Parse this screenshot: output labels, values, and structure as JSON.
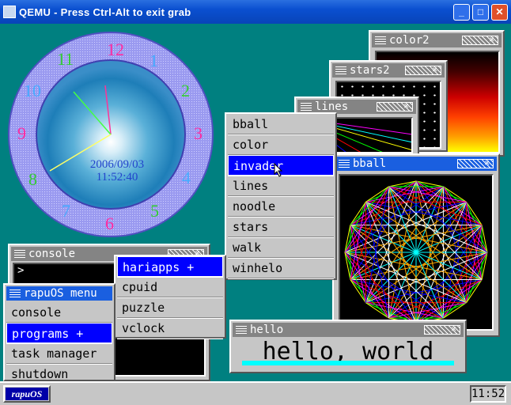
{
  "host": {
    "title": "QEMU - Press Ctrl-Alt to exit grab",
    "buttons": {
      "minimize": "_",
      "maximize": "□",
      "close": "✕"
    }
  },
  "clock_widget": {
    "date": "2006/09/03",
    "time": "11:52:40",
    "numbers": [
      "12",
      "1",
      "2",
      "3",
      "4",
      "5",
      "6",
      "7",
      "8",
      "9",
      "10",
      "11"
    ]
  },
  "windows": {
    "color2": {
      "title": "color2"
    },
    "stars2": {
      "title": "stars2"
    },
    "lines": {
      "title": "lines"
    },
    "bball": {
      "title": "bball"
    },
    "console": {
      "title": "console",
      "prompt": ">"
    },
    "hello": {
      "title": "hello",
      "text": "hello, world"
    }
  },
  "apps_menu": {
    "items": [
      "bball",
      "color",
      "invader",
      "lines",
      "noodle",
      "stars",
      "walk",
      "winhelo"
    ],
    "selected": 2
  },
  "hariapps_menu": {
    "items": [
      "hariapps +",
      "cpuid",
      "puzzle",
      "vclock"
    ],
    "selected": 0
  },
  "main_menu": {
    "title": "rapuOS menu",
    "items": [
      "console",
      "programs +",
      "task manager",
      "shutdown"
    ],
    "selected": 1
  },
  "taskbar": {
    "start_label": "rapuOS",
    "clock": "11:52"
  },
  "colors": {
    "desktop": "#008080",
    "active_title": "#1a5fe0",
    "menu_selected": "#0000ff",
    "hello_bar": "#00ffff"
  }
}
